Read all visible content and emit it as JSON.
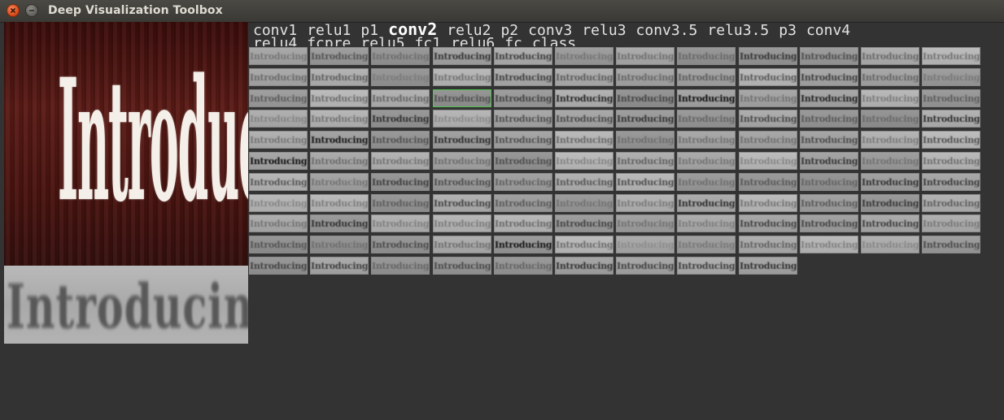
{
  "window": {
    "title": "Deep Visualization Toolbox",
    "close_icon": "close-icon",
    "minimize_icon": "minimize-icon"
  },
  "input_image": {
    "text": "Introducing"
  },
  "unit_image": {
    "text": "Introducing"
  },
  "layers": {
    "row1": [
      "conv1",
      "relu1",
      "p1",
      "conv2",
      "relu2",
      "p2",
      "conv3",
      "relu3",
      "conv3.5",
      "relu3.5",
      "p3",
      "conv4"
    ],
    "row2": [
      "relu4",
      "fcpre",
      "relu5",
      "fc1",
      "relu6",
      "fc",
      "class"
    ],
    "active": "conv2"
  },
  "grid": {
    "columns": 12,
    "rows": 11,
    "count": 129,
    "selected_index": 27,
    "tile_text": "Introducing"
  }
}
